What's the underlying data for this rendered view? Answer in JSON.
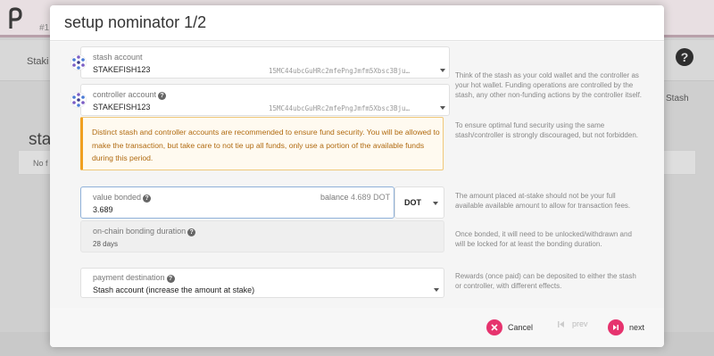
{
  "background": {
    "logo_text": "#1",
    "nav_left": "Staki",
    "right_label": "Stash",
    "heading": "sta",
    "card_text": "No f"
  },
  "modal": {
    "title": "setup nominator 1/2",
    "stash": {
      "label": "stash account",
      "name": "STAKEFISH123",
      "address": "15MC44ubcGuHRc2mfePngJmfm5Xbsc3Bju…"
    },
    "controller": {
      "label": "controller account",
      "name": "STAKEFISH123",
      "address": "15MC44ubcGuHRc2mfePngJmfm5Xbsc3Bju…"
    },
    "warning": "Distinct stash and controller accounts are recommended to ensure fund security. You will be allowed to make the transaction, but take care to not tie up all funds, only use a portion of the available funds during this period.",
    "value_bonded": {
      "label": "value bonded",
      "balance_label": "balance",
      "balance_value": "4.689 DOT",
      "value": "3.689",
      "unit": "DOT"
    },
    "bonding_duration": {
      "label": "on-chain bonding duration",
      "value": "28 days"
    },
    "payment_destination": {
      "label": "payment destination",
      "value": "Stash account (increase the amount at stake)"
    },
    "hints": {
      "accounts": "Think of the stash as your cold wallet and the controller as your hot wallet. Funding operations are controlled by the stash, any other non-funding actions by the controller itself.",
      "security": "To ensure optimal fund security using the same stash/controller is strongly discouraged, but not forbidden.",
      "amount": "The amount placed at-stake should not be your full available available amount to allow for transaction fees.",
      "duration": "Once bonded, it will need to be unlocked/withdrawn and will be locked for at least the bonding duration.",
      "rewards": "Rewards (once paid) can be deposited to either the stash or controller, with different effects."
    },
    "footer": {
      "cancel": "Cancel",
      "prev": "prev",
      "next": "next"
    }
  },
  "colors": {
    "accent": "#e6336e",
    "warning_border": "#f0a020",
    "warning_text": "#b06a10"
  }
}
